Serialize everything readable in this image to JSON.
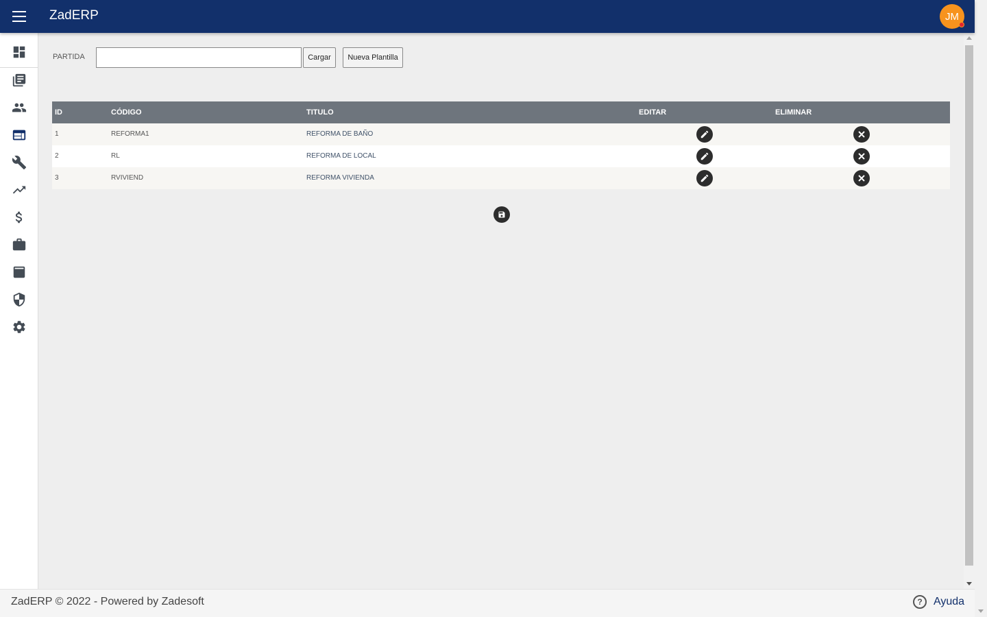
{
  "header": {
    "title": "ZadERP",
    "avatar_initials": "JM",
    "bar_color": "#12306b",
    "avatar_color": "#f7931e"
  },
  "sidebar": {
    "items": [
      {
        "icon": "dashboard-icon",
        "active": false
      },
      {
        "icon": "library-books-icon",
        "active": false
      },
      {
        "icon": "people-icon",
        "active": false
      },
      {
        "icon": "web-icon",
        "active": true
      },
      {
        "icon": "wrench-icon",
        "active": false
      },
      {
        "icon": "trending-up-icon",
        "active": false
      },
      {
        "icon": "dollar-icon",
        "active": false
      },
      {
        "icon": "briefcase-icon",
        "active": false
      },
      {
        "icon": "archive-upload-icon",
        "active": false
      },
      {
        "icon": "shield-icon",
        "active": false
      },
      {
        "icon": "gear-icon",
        "active": false
      }
    ]
  },
  "form": {
    "partida_label": "PARTIDA",
    "partida_value": "",
    "cargar_label": "Cargar",
    "nueva_label": "Nueva Plantilla"
  },
  "table": {
    "headers": {
      "id": "ID",
      "codigo": "CÓDIGO",
      "titulo": "TITULO",
      "editar": "EDITAR",
      "eliminar": "ELIMINAR"
    },
    "rows": [
      {
        "id": "1",
        "codigo": "REFORMA1",
        "titulo": "REFORMA DE BAÑO"
      },
      {
        "id": "2",
        "codigo": "RL",
        "titulo": "REFORMA DE LOCAL"
      },
      {
        "id": "3",
        "codigo": "RVIVIEND",
        "titulo": "REFORMA VIVIENDA"
      }
    ],
    "header_color": "#6e757d"
  },
  "footer": {
    "text": "ZadERP © 2022 - Powered by Zadesoft",
    "help_label": "Ayuda",
    "help_glyph": "?"
  }
}
